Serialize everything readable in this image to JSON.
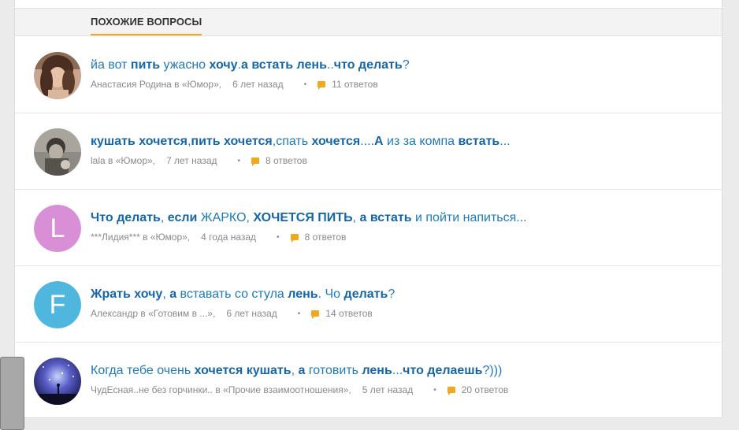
{
  "section": {
    "title": "Похожие вопросы"
  },
  "questions": [
    {
      "title": [
        {
          "t": "йа вот ",
          "b": false
        },
        {
          "t": "пить",
          "b": true
        },
        {
          "t": " ужасно ",
          "b": false
        },
        {
          "t": "хочу",
          "b": true
        },
        {
          "t": ".",
          "b": false
        },
        {
          "t": "а встать лень",
          "b": true
        },
        {
          "t": "..",
          "b": false
        },
        {
          "t": "что делать",
          "b": true
        },
        {
          "t": "?",
          "b": false
        }
      ],
      "author": "Анастасия Родина",
      "in": "в",
      "category": "«Юмор»,",
      "time": "6 лет назад",
      "answers": "11 ответов",
      "avatar": "photo-woman"
    },
    {
      "title": [
        {
          "t": "кушать хочется",
          "b": true
        },
        {
          "t": ",",
          "b": false
        },
        {
          "t": "пить хочется",
          "b": true
        },
        {
          "t": ",спать ",
          "b": false
        },
        {
          "t": "хочется",
          "b": true
        },
        {
          "t": "....",
          "b": false
        },
        {
          "t": "А",
          "b": true
        },
        {
          "t": " из за компа ",
          "b": false
        },
        {
          "t": "встать",
          "b": true
        },
        {
          "t": "...",
          "b": false
        }
      ],
      "author": "lala",
      "in": "в",
      "category": "«Юмор»,",
      "time": "7 лет назад",
      "answers": "8 ответов",
      "avatar": "photo-child"
    },
    {
      "title": [
        {
          "t": "Что делать",
          "b": true
        },
        {
          "t": ", ",
          "b": false
        },
        {
          "t": "если",
          "b": true
        },
        {
          "t": " ЖАРКО, ",
          "b": false
        },
        {
          "t": "ХОЧЕТСЯ ПИТЬ",
          "b": true
        },
        {
          "t": ", ",
          "b": false
        },
        {
          "t": "а встать",
          "b": true
        },
        {
          "t": " и пойти напиться...",
          "b": false
        }
      ],
      "author": "***Лидия***",
      "in": "в",
      "category": "«Юмор»,",
      "time": "4 года назад",
      "answers": "8 ответов",
      "avatar": "letter",
      "letter": "L",
      "color": "#d98fd6"
    },
    {
      "title": [
        {
          "t": "Жрать хочу",
          "b": true
        },
        {
          "t": ", ",
          "b": false
        },
        {
          "t": "а",
          "b": true
        },
        {
          "t": " вставать со стула ",
          "b": false
        },
        {
          "t": "лень",
          "b": true
        },
        {
          "t": ". Чо ",
          "b": false
        },
        {
          "t": "делать",
          "b": true
        },
        {
          "t": "?",
          "b": false
        }
      ],
      "author": "Александр",
      "in": "в",
      "category": "«Готовим в ...»,",
      "time": "6 лет назад",
      "answers": "14 ответов",
      "avatar": "letter",
      "letter": "F",
      "color": "#4fb6dd"
    },
    {
      "title": [
        {
          "t": "Когда тебе очень ",
          "b": false
        },
        {
          "t": "хочется кушать",
          "b": true
        },
        {
          "t": ", ",
          "b": false
        },
        {
          "t": "а",
          "b": true
        },
        {
          "t": " готовить ",
          "b": false
        },
        {
          "t": "лень",
          "b": true
        },
        {
          "t": "...",
          "b": false
        },
        {
          "t": "что делаешь",
          "b": true
        },
        {
          "t": "?)))",
          "b": false
        }
      ],
      "author": "ЧудЕсная..не без горчинки..",
      "in": "в",
      "category": "«Прочие взаимоотношения»,",
      "time": "5 лет назад",
      "answers": "20 ответов",
      "avatar": "photo-night"
    }
  ],
  "colors": {
    "accent": "#f5a623",
    "link": "#1f7ab8",
    "meta": "#8a8a8a"
  }
}
